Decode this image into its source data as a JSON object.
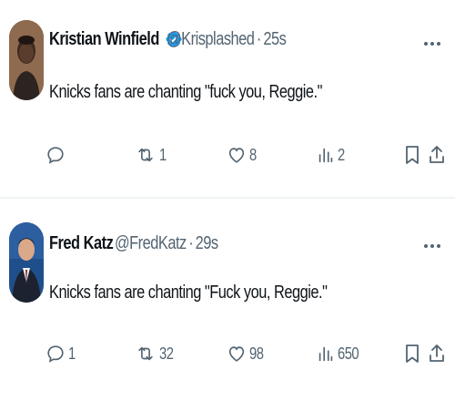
{
  "colors": {
    "text_primary": "#0f1419",
    "text_secondary": "#536471",
    "verified_badge": "#1d9bf0",
    "divider": "#eff3f4"
  },
  "tweets": [
    {
      "author": {
        "name": "Kristian Winfield",
        "handle": "@Krisplashed",
        "verified": true,
        "avatar_icon": "profile-photo"
      },
      "time": "25s",
      "separator": "·",
      "text": "Knicks fans are chanting \"fuck you, Reggie.\"",
      "actions": {
        "replies": "",
        "retweets": "1",
        "likes": "8",
        "views": "2"
      }
    },
    {
      "author": {
        "name": "Fred Katz",
        "handle": "@FredKatz",
        "verified": false,
        "avatar_icon": "profile-photo"
      },
      "time": "29s",
      "separator": "·",
      "text": "Knicks fans are chanting \"Fuck you, Reggie.\"",
      "actions": {
        "replies": "1",
        "retweets": "32",
        "likes": "98",
        "views": "650"
      }
    }
  ],
  "icons": {
    "verified": "verified-badge-icon",
    "more": "more-options-icon",
    "reply": "reply-icon",
    "retweet": "retweet-icon",
    "like": "heart-icon",
    "views": "views-chart-icon",
    "bookmark": "bookmark-icon",
    "share": "share-icon"
  }
}
